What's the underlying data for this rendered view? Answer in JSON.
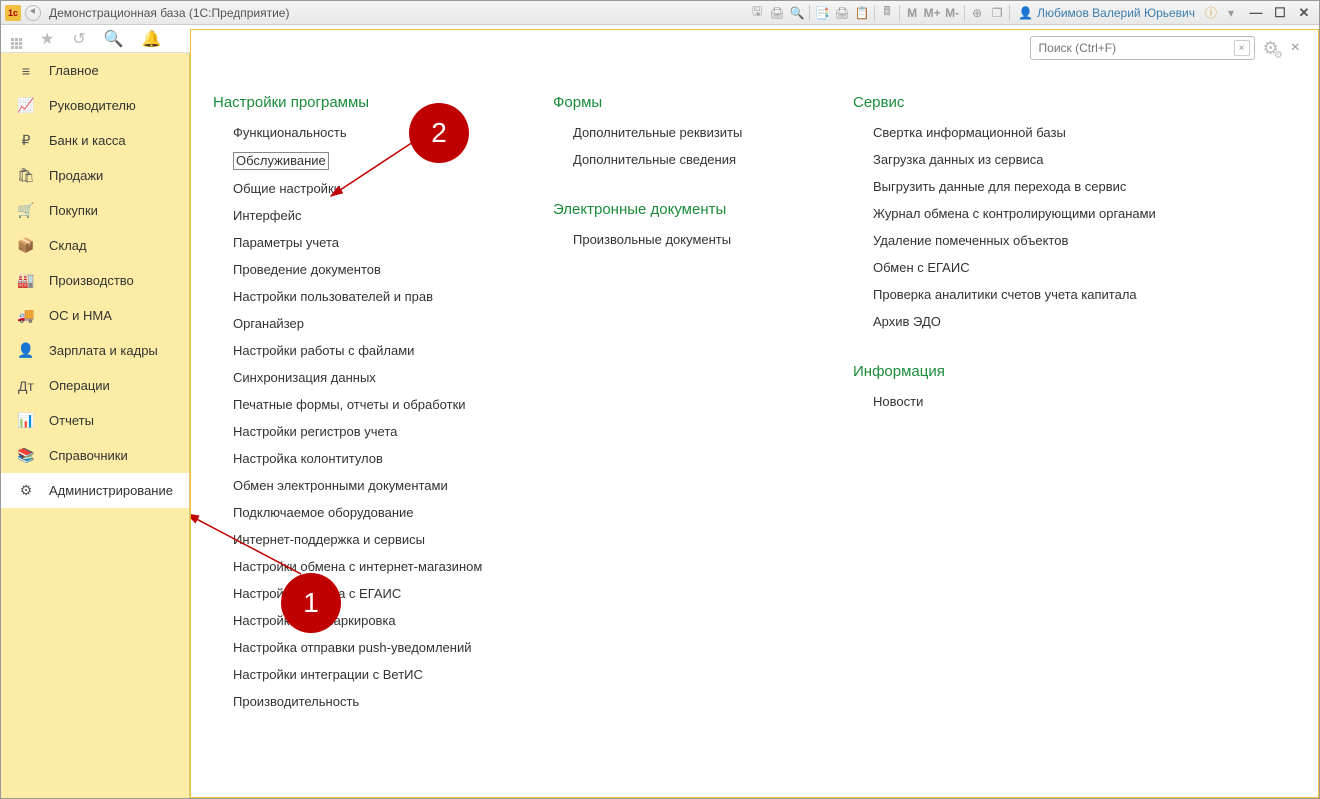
{
  "window": {
    "title": "Демонстрационная база  (1С:Предприятие)",
    "user": "Любимов Валерий Юрьевич"
  },
  "sidebar": {
    "items": [
      {
        "icon": "≡",
        "label": "Главное"
      },
      {
        "icon": "📈",
        "label": "Руководителю"
      },
      {
        "icon": "₽",
        "label": "Банк и касса"
      },
      {
        "icon": "🛍",
        "label": "Продажи"
      },
      {
        "icon": "🛒",
        "label": "Покупки"
      },
      {
        "icon": "📦",
        "label": "Склад"
      },
      {
        "icon": "🏭",
        "label": "Производство"
      },
      {
        "icon": "🚚",
        "label": "ОС и НМА"
      },
      {
        "icon": "👤",
        "label": "Зарплата и кадры"
      },
      {
        "icon": "Дт",
        "label": "Операции"
      },
      {
        "icon": "📊",
        "label": "Отчеты"
      },
      {
        "icon": "📚",
        "label": "Справочники"
      },
      {
        "icon": "⚙",
        "label": "Администрирование"
      }
    ],
    "active_index": 12
  },
  "search": {
    "placeholder": "Поиск (Ctrl+F)"
  },
  "sections": [
    {
      "title": "Настройки программы",
      "links": [
        "Функциональность",
        "Обслуживание",
        "Общие настройки",
        "Интерфейс",
        "Параметры учета",
        "Проведение документов",
        "Настройки пользователей и прав",
        "Органайзер",
        "Настройки работы с файлами",
        "Синхронизация данных",
        "Печатные формы, отчеты и обработки",
        "Настройки регистров учета",
        "Настройка колонтитулов",
        "Обмен электронными документами",
        "Подключаемое оборудование",
        "Интернет-поддержка и сервисы",
        "Настройки обмена с интернет-магазином",
        "Настройки обмена с ЕГАИС",
        "Настройки ИС Маркировка",
        "Настройка отправки push-уведомлений",
        "Настройки интеграции с ВетИС",
        "Производительность"
      ],
      "boxed_index": 1
    },
    {
      "title": "Формы",
      "links": [
        "Дополнительные реквизиты",
        "Дополнительные сведения"
      ]
    },
    {
      "title": "Электронные документы",
      "links": [
        "Произвольные документы"
      ]
    },
    {
      "title": "Сервис",
      "links": [
        "Свертка информационной базы",
        "Загрузка данных из сервиса",
        "Выгрузить данные для перехода в сервис",
        "Журнал обмена с контролирующими органами",
        "Удаление помеченных объектов",
        "Обмен с ЕГАИС",
        "Проверка аналитики счетов учета капитала",
        "Архив ЭДО"
      ]
    },
    {
      "title": "Информация",
      "links": [
        "Новости"
      ]
    }
  ],
  "annotations": {
    "marker1": "1",
    "marker2": "2"
  }
}
